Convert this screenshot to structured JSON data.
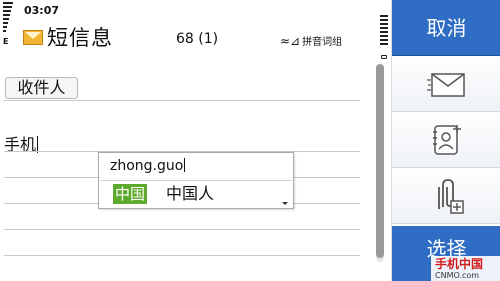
{
  "status": {
    "time": "03:07",
    "network_indicator": "E"
  },
  "header": {
    "title": "短信息",
    "counter": "68 (1)",
    "input_method": "拼音词组",
    "icon": "envelope-icon"
  },
  "recipient": {
    "button_label": "收件人"
  },
  "message": {
    "text": "手机"
  },
  "ime_popup": {
    "pinyin": "zhong.guo",
    "candidates": [
      "中国",
      "中国人"
    ],
    "selected_index": 0
  },
  "softkeys": {
    "cancel_label": "取消",
    "options_label": "选择",
    "icons": [
      "envelope-icon",
      "contacts-icon",
      "attachment-icon"
    ]
  },
  "watermark": {
    "brand": "手机中国",
    "domain": "CNMO.com"
  },
  "colors": {
    "accent": "#2f6cc4",
    "candidate_highlight": "#5daa2e"
  }
}
